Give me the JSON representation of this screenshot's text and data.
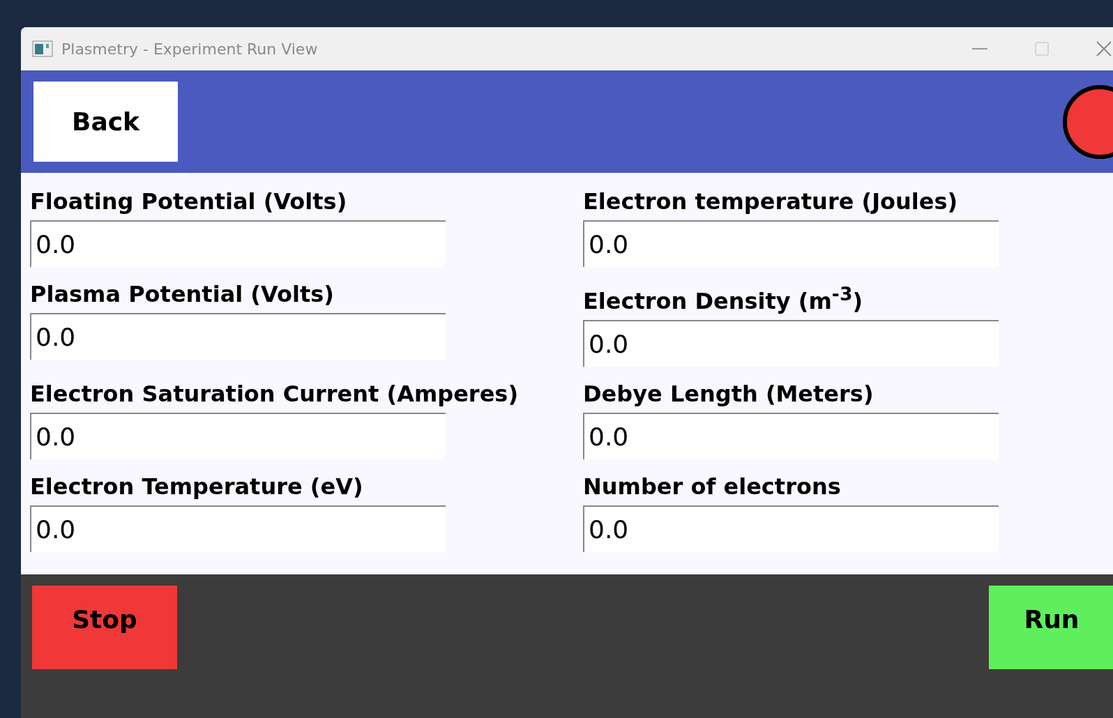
{
  "window": {
    "title": "Plasmetry - Experiment Run View"
  },
  "header": {
    "back_button": "Back",
    "indicator": {
      "color": "#ef3837"
    }
  },
  "fields": [
    {
      "label": "Floating Potential (Volts)",
      "value": "0.0"
    },
    {
      "label": "Electron temperature (Joules)",
      "value": "0.0"
    },
    {
      "label": "Plasma Potential (Volts)",
      "value": "0.0"
    },
    {
      "label": "Electron Density (m$^{-3}$)",
      "value": "0.0"
    },
    {
      "label": "Electron Saturation Current (Amperes)",
      "value": "0.0"
    },
    {
      "label": "Debye Length (Meters)",
      "value": "0.0"
    },
    {
      "label": "Electron Temperature (eV)",
      "value": "0.0"
    },
    {
      "label": "Number of electrons",
      "value": "0.0"
    }
  ],
  "footer": {
    "stop_button": "Stop",
    "run_button": "Run"
  }
}
